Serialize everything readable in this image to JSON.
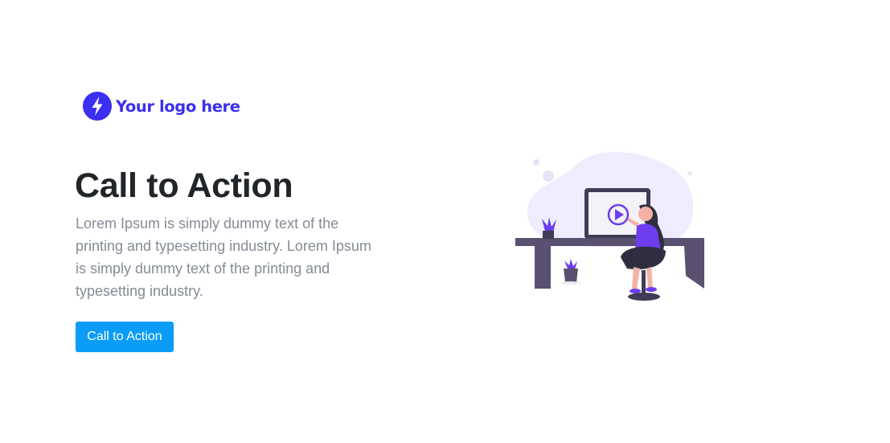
{
  "logo": {
    "text": "Your logo here",
    "icon": "lightning-bolt-icon",
    "color": "#3b2ff2"
  },
  "hero": {
    "title": "Call to Action",
    "description": "Lorem Ipsum is simply dummy text of the printing and typesetting industry. Lorem Ipsum is simply dummy text of the printing and typesetting industry.",
    "cta_label": "Call to Action",
    "cta_color": "#0a9cf7"
  },
  "illustration": {
    "subject": "woman-at-desk-watching-video-illustration",
    "accent_color": "#6c3ef0",
    "furniture_color": "#5a5170",
    "background_blob_color": "#efedfd"
  }
}
